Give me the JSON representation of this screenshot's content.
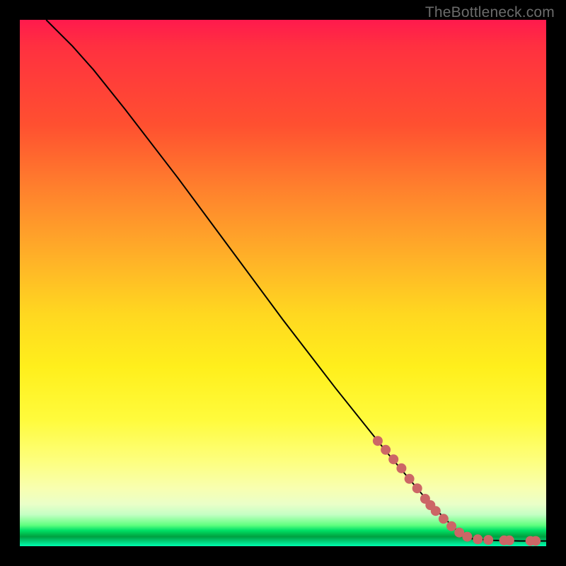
{
  "watermark": "TheBottleneck.com",
  "colors": {
    "background": "#000000",
    "curve_stroke": "#000000",
    "dot_fill": "#cc6666"
  },
  "chart_data": {
    "type": "line",
    "title": "",
    "xlabel": "",
    "ylabel": "",
    "xlim": [
      0,
      100
    ],
    "ylim": [
      0,
      100
    ],
    "curve_points": [
      {
        "x": 5.0,
        "y": 100.0
      },
      {
        "x": 7.0,
        "y": 98.0
      },
      {
        "x": 10.0,
        "y": 95.0
      },
      {
        "x": 14.0,
        "y": 90.5
      },
      {
        "x": 20.0,
        "y": 83.0
      },
      {
        "x": 30.0,
        "y": 70.0
      },
      {
        "x": 40.0,
        "y": 56.5
      },
      {
        "x": 50.0,
        "y": 43.0
      },
      {
        "x": 60.0,
        "y": 30.0
      },
      {
        "x": 70.0,
        "y": 17.5
      },
      {
        "x": 78.0,
        "y": 8.0
      },
      {
        "x": 83.0,
        "y": 3.0
      },
      {
        "x": 86.0,
        "y": 1.4
      },
      {
        "x": 90.0,
        "y": 1.1
      },
      {
        "x": 95.0,
        "y": 1.0
      },
      {
        "x": 100.0,
        "y": 1.0
      }
    ],
    "dots": [
      {
        "x": 68.0,
        "y": 20.0
      },
      {
        "x": 69.5,
        "y": 18.3
      },
      {
        "x": 71.0,
        "y": 16.5
      },
      {
        "x": 72.5,
        "y": 14.8
      },
      {
        "x": 74.0,
        "y": 12.8
      },
      {
        "x": 75.5,
        "y": 11.0
      },
      {
        "x": 77.0,
        "y": 9.0
      },
      {
        "x": 78.0,
        "y": 7.8
      },
      {
        "x": 79.0,
        "y": 6.7
      },
      {
        "x": 80.5,
        "y": 5.2
      },
      {
        "x": 82.0,
        "y": 3.8
      },
      {
        "x": 83.5,
        "y": 2.6
      },
      {
        "x": 85.0,
        "y": 1.8
      },
      {
        "x": 87.0,
        "y": 1.3
      },
      {
        "x": 89.0,
        "y": 1.2
      },
      {
        "x": 92.0,
        "y": 1.1
      },
      {
        "x": 93.0,
        "y": 1.1
      },
      {
        "x": 97.0,
        "y": 1.0
      },
      {
        "x": 98.0,
        "y": 1.0
      }
    ]
  }
}
